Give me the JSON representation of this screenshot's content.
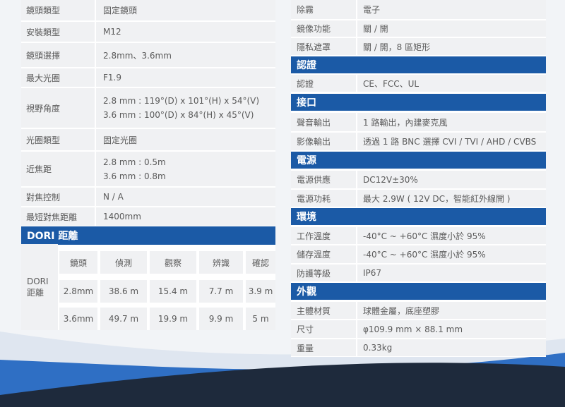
{
  "left": {
    "rows": [
      {
        "label": "鏡頭類型",
        "value": "固定鏡頭"
      },
      {
        "label": "安裝類型",
        "value": "M12"
      },
      {
        "label": "鏡頭選擇",
        "value": "2.8mm、3.6mm"
      },
      {
        "label": "最大光圈",
        "value": "F1.9"
      },
      {
        "label": "視野角度",
        "value_lines": [
          "2.8 mm : 119°(D) x 101°(H) x 54°(V)",
          "3.6 mm : 100°(D) x 84°(H) x 45°(V)"
        ]
      },
      {
        "label": "光圈類型",
        "value": "固定光圈"
      },
      {
        "label": "近焦距",
        "value_lines": [
          "2.8 mm : 0.5m",
          "3.6 mm : 0.8m"
        ]
      },
      {
        "label": "對焦控制",
        "value": "N / A"
      },
      {
        "label": "最短對焦距離",
        "value": "1400mm"
      }
    ],
    "dori": {
      "title": "DORI 距離",
      "side_label": [
        "DORI",
        "距離"
      ],
      "headers": [
        "鏡頭",
        "偵測",
        "觀察",
        "辨識",
        "確認"
      ],
      "rows": [
        [
          "2.8mm",
          "38.6 m",
          "15.4 m",
          "7.7 m",
          "3.9 m"
        ],
        [
          "3.6mm",
          "49.7 m",
          "19.9 m",
          "9.9 m",
          "5 m"
        ]
      ]
    }
  },
  "right": {
    "top_rows": [
      {
        "label": "除霧",
        "value": "電子"
      },
      {
        "label": "鏡像功能",
        "value": "關 / 開"
      },
      {
        "label": "隱私遮罩",
        "value": "關 / 開，8 區矩形"
      }
    ],
    "sections": [
      {
        "title": "認證",
        "rows": [
          {
            "label": "認證",
            "value": "CE、FCC、UL"
          }
        ]
      },
      {
        "title": "接口",
        "rows": [
          {
            "label": "聲音輸出",
            "value": "1 路輸出，內建麥克風"
          },
          {
            "label": "影像輸出",
            "value": "透過 1 路 BNC 選擇 CVI / TVI / AHD / CVBS"
          }
        ]
      },
      {
        "title": "電源",
        "rows": [
          {
            "label": "電源供應",
            "value": "DC12V±30%"
          },
          {
            "label": "電源功耗",
            "value": "最大 2.9W ( 12V DC，智能紅外線開 )"
          }
        ]
      },
      {
        "title": "環境",
        "rows": [
          {
            "label": "工作溫度",
            "value": "-40°C ~ +60°C  濕度小於 95%"
          },
          {
            "label": "儲存溫度",
            "value": "-40°C ~ +60°C  濕度小於 95%"
          },
          {
            "label": "防護等級",
            "value": "IP67"
          }
        ]
      },
      {
        "title": "外觀",
        "rows": [
          {
            "label": "主體材質",
            "value": "球體金屬，底座塑膠"
          },
          {
            "label": "尺寸",
            "value": "φ109.9 mm × 88.1 mm"
          },
          {
            "label": "重量",
            "value": "0.33kg"
          }
        ]
      }
    ]
  },
  "colors": {
    "header_blue": "#1b5aa6",
    "row_gray": "#f0f1f3",
    "wave_dark": "#1e2a3c",
    "wave_blue": "#2f6fc4"
  }
}
